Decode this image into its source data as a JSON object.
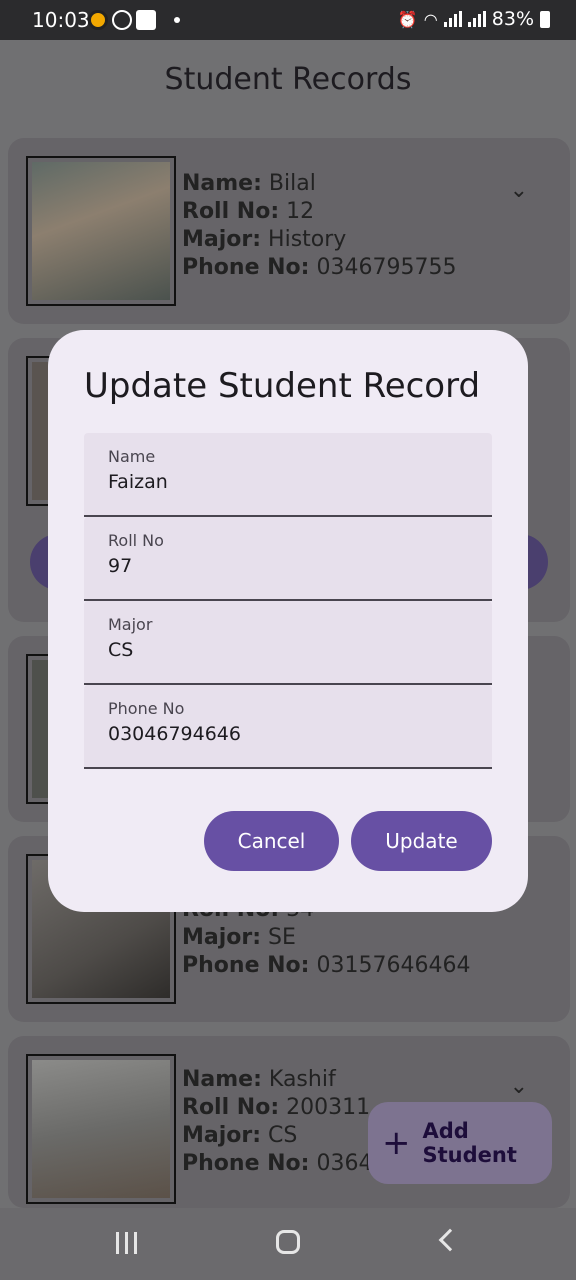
{
  "status_bar": {
    "time": "10:03",
    "battery": "83%"
  },
  "app": {
    "title": "Student Records"
  },
  "students": [
    {
      "name_label": "Name:",
      "name": "Bilal",
      "roll_label": "Roll No:",
      "roll": "12",
      "major_label": "Major:",
      "major": "History",
      "phone_label": "Phone No:",
      "phone": "0346795755"
    },
    {
      "roll_label": "Roll No:",
      "roll": "34",
      "major_label": "Major:",
      "major": "SE",
      "phone_label": "Phone No:",
      "phone": "03157646464"
    },
    {
      "name_label": "Name:",
      "name": "Kashif",
      "roll_label": "Roll No:",
      "roll": "200311",
      "major_label": "Major:",
      "major": "CS",
      "phone_label": "Phone No:",
      "phone": "03646"
    }
  ],
  "dialog": {
    "title": "Update Student Record",
    "fields": [
      {
        "label": "Name",
        "value": "Faizan"
      },
      {
        "label": "Roll No",
        "value": "97"
      },
      {
        "label": "Major",
        "value": "CS"
      },
      {
        "label": "Phone No",
        "value": "03046794646"
      }
    ],
    "cancel_label": "Cancel",
    "update_label": "Update"
  },
  "fab": {
    "label": "Add Student"
  },
  "colors": {
    "primary": "#6750a4",
    "dialog_bg": "#f0ebf5",
    "field_bg": "#e7e0ec"
  }
}
